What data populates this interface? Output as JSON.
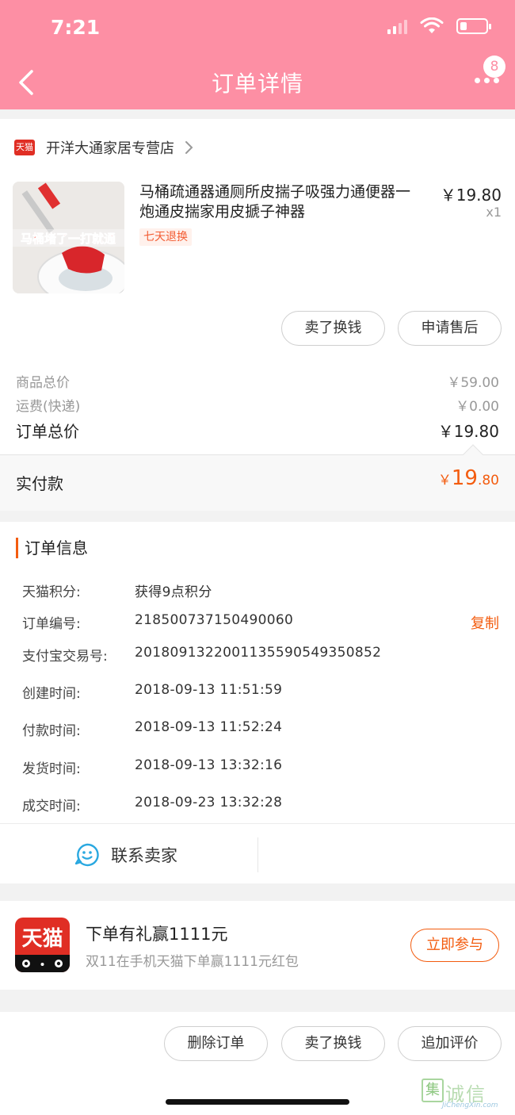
{
  "status_bar": {
    "time": "7:21"
  },
  "nav": {
    "title": "订单详情",
    "badge_count": "8"
  },
  "store": {
    "badge": "天猫",
    "name": "开洋大通家居专营店"
  },
  "product": {
    "title": "马桶疏通器通厕所皮揣子吸强力通便器一炮通皮揣家用皮搋子神器",
    "tag": "七天退换",
    "price": "￥19.80",
    "quantity": "x1",
    "image_caption": "马桶堵了一打就通"
  },
  "item_actions": {
    "sell": "卖了换钱",
    "after_sale": "申请售后"
  },
  "summary": {
    "goods_total_label": "商品总价",
    "goods_total_value": "￥59.00",
    "shipping_label": "运费(快递)",
    "shipping_value": "￥0.00",
    "order_total_label": "订单总价",
    "order_total_value": "￥19.80",
    "paid_label": "实付款",
    "paid_currency": "￥",
    "paid_integer": "19",
    "paid_decimal": ".80"
  },
  "order_info": {
    "heading": "订单信息",
    "points_label": "天猫积分:",
    "points_value": "获得9点积分",
    "order_no_label": "订单编号:",
    "order_no_value": "218500737150490060",
    "copy_label": "复制",
    "alipay_label": "支付宝交易号:",
    "alipay_value": "2018091322001135590549350852",
    "created_label": "创建时间:",
    "created_value": "2018-09-13 11:51:59",
    "paid_label": "付款时间:",
    "paid_value": "2018-09-13 11:52:24",
    "shipped_label": "发货时间:",
    "shipped_value": "2018-09-13 13:32:16",
    "completed_label": "成交时间:",
    "completed_value": "2018-09-23 13:32:28",
    "contact_label": "联系卖家"
  },
  "promo": {
    "logo_text": "天猫",
    "title": "下单有礼赢1111元",
    "subtitle": "双11在手机天猫下单赢1111元红包",
    "button": "立即参与"
  },
  "bottom_actions": {
    "delete": "删除订单",
    "sell": "卖了换钱",
    "review": "追加评价"
  },
  "watermark": {
    "text": "诚信",
    "box": "集",
    "url": "JiChengXin.com"
  },
  "colors": {
    "header": "#fd8fa4",
    "accent": "#f35c0f",
    "tmall_red": "#e02e24"
  }
}
